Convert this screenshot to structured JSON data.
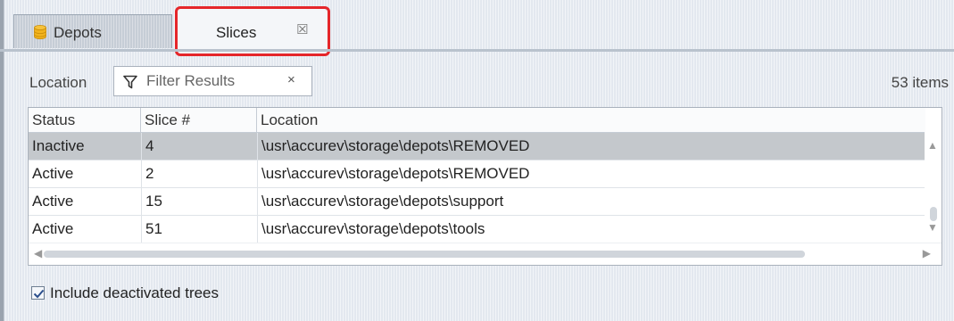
{
  "tabs": [
    {
      "label": "Depots",
      "icon": "database-icon",
      "active": false
    },
    {
      "label": "Slices",
      "close_glyph": "☒",
      "active": true
    }
  ],
  "toolbar": {
    "location_label": "Location",
    "filter_placeholder": "Filter Results",
    "filter_value": "",
    "clear_glyph": "×",
    "item_count": "53 items"
  },
  "table": {
    "columns": [
      "Status",
      "Slice #",
      "Location"
    ],
    "rows": [
      {
        "status": "Inactive",
        "slice": "4",
        "location": "\\usr\\accurev\\storage\\depots\\REMOVED",
        "selected": true
      },
      {
        "status": "Active",
        "slice": "2",
        "location": "\\usr\\accurev\\storage\\depots\\REMOVED",
        "selected": false
      },
      {
        "status": "Active",
        "slice": "15",
        "location": "\\usr\\accurev\\storage\\depots\\support",
        "selected": false
      },
      {
        "status": "Active",
        "slice": "51",
        "location": "\\usr\\accurev\\storage\\depots\\tools",
        "selected": false
      }
    ]
  },
  "include_deactivated": {
    "label": "Include deactivated trees",
    "checked": true
  },
  "colors": {
    "highlight": "#e5262a",
    "selected_row": "#c4c8cc",
    "background": "#e3e8ef"
  }
}
